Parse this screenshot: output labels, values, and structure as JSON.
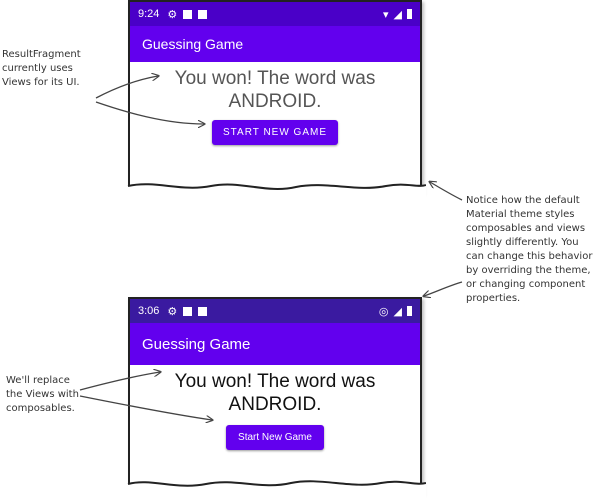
{
  "colors": {
    "status_bar_1": "#4a00c8",
    "status_bar_2": "#3a1aa0",
    "app_bar": "#6200ee",
    "button": "#6200ee"
  },
  "screen1": {
    "status_time": "9:24",
    "status_icons": [
      "gear-icon",
      "photo-icon",
      "sd-card-icon"
    ],
    "status_right_icons": [
      "wifi-icon",
      "signal-icon",
      "battery-icon"
    ],
    "app_title": "Guessing Game",
    "message_line1": "You won! The word was",
    "message_line2": "ANDROID.",
    "button_label": "START NEW GAME"
  },
  "screen2": {
    "status_time": "3:06",
    "status_icons": [
      "gear-icon",
      "photo-icon",
      "sd-card-icon"
    ],
    "status_right_icons": [
      "location-icon",
      "signal-icon",
      "battery-icon"
    ],
    "app_title": "Guessing Game",
    "message_line1": "You won! The word was",
    "message_line2": "ANDROID.",
    "button_label": "Start New Game"
  },
  "annotations": {
    "result_fragment": "ResultFragment\ncurrently uses\nViews for its UI.",
    "material_theme": "Notice how the default\nMaterial theme styles\ncomposables and views\nslightly differently. You\ncan change this behavior\nby overriding the theme,\nor changing component\nproperties.",
    "replace_views": "We'll replace\nthe Views with\ncomposables."
  }
}
